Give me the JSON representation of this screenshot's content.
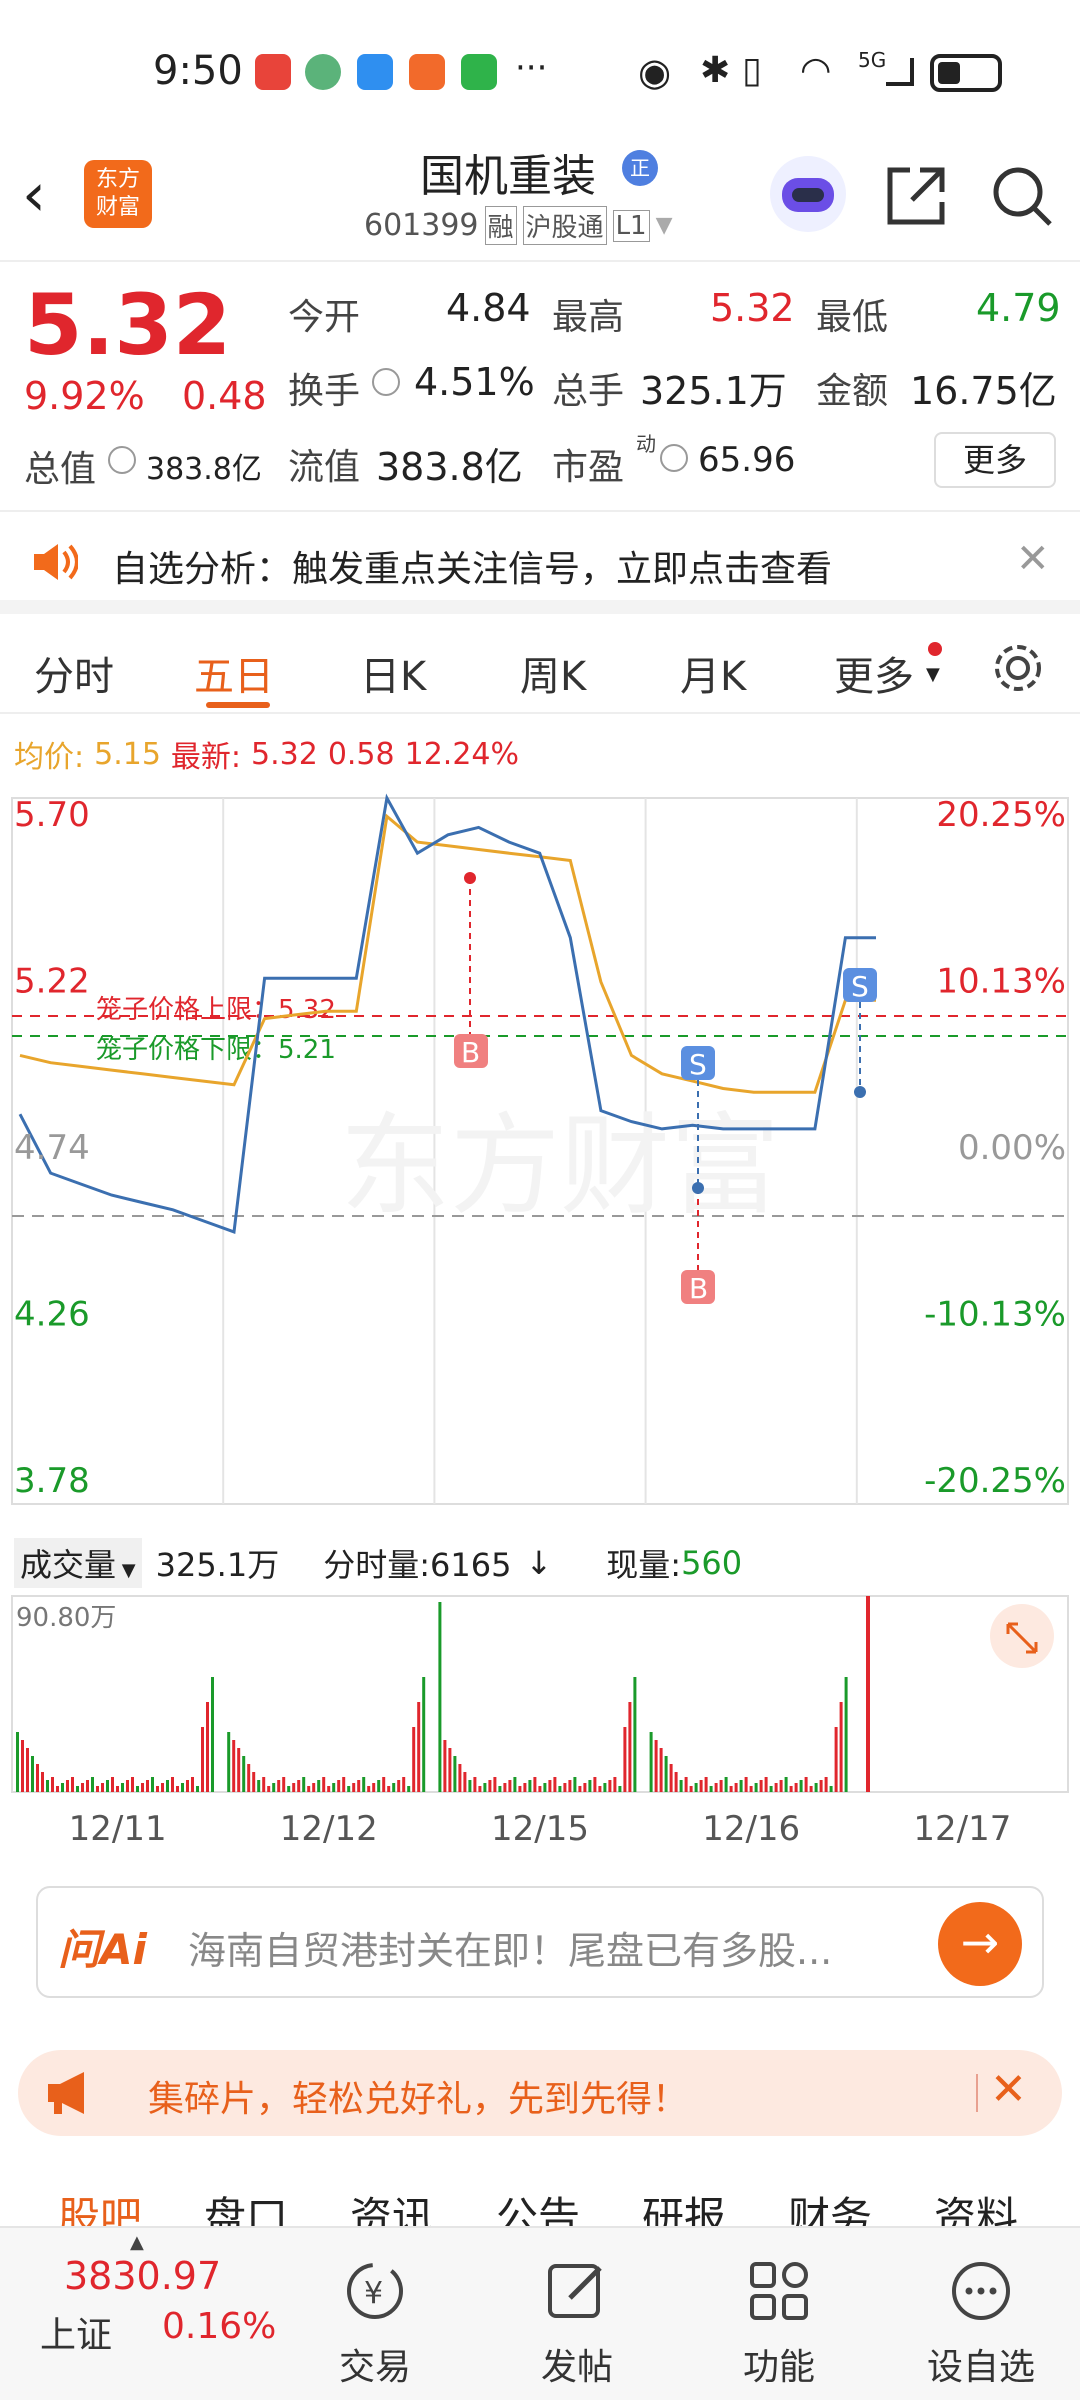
{
  "status_bar": {
    "time": "9:50",
    "network": "5G"
  },
  "header": {
    "stock_name": "国机重装",
    "name_badge": "正",
    "stock_code": "601399",
    "tags": [
      "融",
      "沪股通",
      "L1"
    ],
    "logo_text_1": "东方",
    "logo_text_2": "财富"
  },
  "quote": {
    "price": "5.32",
    "change_pct": "9.92%",
    "change": "0.48",
    "open_label": "今开",
    "open": "4.84",
    "high_label": "最高",
    "high": "5.32",
    "low_label": "最低",
    "low": "4.79",
    "turnover_label": "换手",
    "turnover": "4.51%",
    "volume_label": "总手",
    "volume": "325.1万",
    "amount_label": "金额",
    "amount": "16.75亿",
    "mcap_label": "总值",
    "mcap": "383.8亿",
    "float_label": "流值",
    "float_mcap": "383.8亿",
    "pe_label": "市盈",
    "pe_super": "动",
    "pe": "65.96",
    "more_button": "更多"
  },
  "notice": {
    "text": "自选分析：触发重点关注信号，立即点击查看"
  },
  "tabs": [
    "分时",
    "五日",
    "日K",
    "周K",
    "月K",
    "更多"
  ],
  "active_tab": "五日",
  "info_line": {
    "avg_label": "均价:",
    "avg": "5.15",
    "latest_label": "最新:",
    "latest": "5.32",
    "change": "0.58",
    "change_pct": "12.24%"
  },
  "price_axis": {
    "left_labels": [
      "5.70",
      "5.22",
      "4.74",
      "4.26",
      "3.78"
    ],
    "right_labels": [
      "20.25%",
      "10.13%",
      "0.00%",
      "-10.13%",
      "-20.25%"
    ]
  },
  "cage_upper_label": "笼子价格上限：5.32",
  "cage_lower_label": "笼子价格下限：5.21",
  "trade_markers": {
    "buy": "B",
    "sell": "S"
  },
  "watermark": "东方财富",
  "volume_panel": {
    "label": "成交量",
    "total": "325.1万",
    "tick_label": "分时量:6165",
    "current_label": "现量:",
    "current": "560",
    "max_label": "90.80万"
  },
  "date_labels": [
    "12/11",
    "12/12",
    "12/15",
    "12/16",
    "12/17"
  ],
  "chart_data": {
    "type": "line",
    "x": [
      "12/11",
      "12/12",
      "12/15",
      "12/16",
      "12/17"
    ],
    "ylim": [
      3.78,
      5.7
    ],
    "series": [
      {
        "values": [
          4.84,
          4.68,
          4.65,
          4.62,
          4.6,
          4.58,
          4.55,
          4.52,
          5.21,
          5.21,
          5.21,
          5.21,
          5.7,
          5.55,
          5.6,
          5.62,
          5.58,
          5.55,
          5.32,
          4.85,
          4.82,
          4.8,
          4.81,
          4.8,
          4.8,
          4.8,
          4.8,
          5.32,
          5.32
        ]
      },
      {
        "values": [
          5.0,
          4.98,
          4.97,
          4.96,
          4.95,
          4.94,
          4.93,
          4.92,
          5.1,
          5.11,
          5.12,
          5.12,
          5.65,
          5.58,
          5.57,
          5.56,
          5.55,
          5.54,
          5.53,
          5.2,
          5.0,
          4.95,
          4.93,
          4.91,
          4.9,
          4.9,
          4.9,
          5.15,
          5.15
        ]
      }
    ]
  },
  "ai_bar": {
    "logo": "问Ai",
    "placeholder": "海南自贸港封关在即！尾盘已有多股..."
  },
  "promo": {
    "text": "集碎片，轻松兑好礼，先到先得！"
  },
  "bottom_tabs": [
    "股吧",
    "盘口",
    "资讯",
    "公告",
    "研报",
    "财务",
    "资料"
  ],
  "bottom_nav": {
    "index_value": "3830.97",
    "index_name": "上证",
    "index_change": "0.16%",
    "items": [
      "交易",
      "发帖",
      "功能",
      "设自选"
    ]
  },
  "colors": {
    "red": "#e0262d",
    "green": "#1a9a2a",
    "orange": "#ef6a1b",
    "line": "#3b6fb0",
    "avg": "#e8a52c"
  }
}
